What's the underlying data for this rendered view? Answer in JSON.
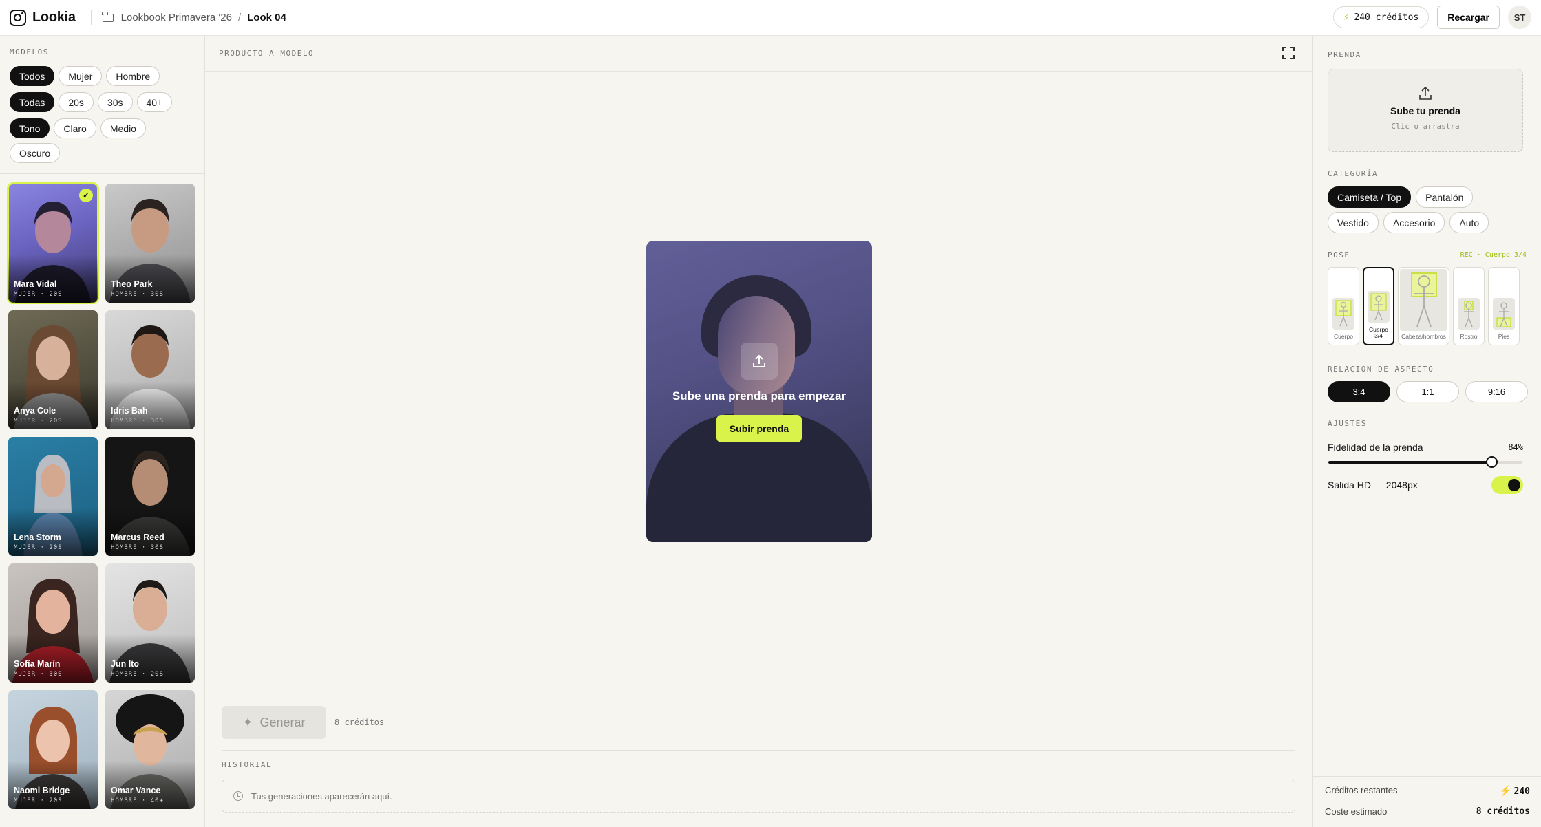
{
  "app": {
    "name": "Lookia"
  },
  "breadcrumb": {
    "project": "Lookbook Primavera '26",
    "separator": "/",
    "current": "Look 04"
  },
  "header": {
    "credits": "240 créditos",
    "reload_label": "Recargar",
    "avatar_initials": "ST"
  },
  "sidebar": {
    "title": "MODELOS",
    "gender_filters": [
      "Todos",
      "Mujer",
      "Hombre"
    ],
    "age_filters": [
      "Todas",
      "20s",
      "30s",
      "40+"
    ],
    "tone_filters": [
      "Tono",
      "Claro",
      "Medio",
      "Oscuro"
    ],
    "models": [
      {
        "name": "Mara Vidal",
        "meta": "MUJER · 20S",
        "selected": true
      },
      {
        "name": "Theo Park",
        "meta": "HOMBRE · 30S"
      },
      {
        "name": "Anya Cole",
        "meta": "MUJER · 20S"
      },
      {
        "name": "Idris Bah",
        "meta": "HOMBRE · 30S"
      },
      {
        "name": "Lena Storm",
        "meta": "MUJER · 20S"
      },
      {
        "name": "Marcus Reed",
        "meta": "HOMBRE · 30S"
      },
      {
        "name": "Sofía Marín",
        "meta": "MUJER · 30S"
      },
      {
        "name": "Jun Ito",
        "meta": "HOMBRE · 20S"
      },
      {
        "name": "Naomi Bridge",
        "meta": "MUJER · 20S"
      },
      {
        "name": "Omar Vance",
        "meta": "HOMBRE · 40+"
      }
    ]
  },
  "main": {
    "title": "PRODUCTO A MODELO",
    "preview_title": "Sube una prenda para empezar",
    "preview_button": "Subir prenda",
    "generate_label": "Generar",
    "generate_cost": "8 créditos",
    "history_title": "HISTORIAL",
    "history_empty": "Tus generaciones aparecerán aquí."
  },
  "panel": {
    "garment_title": "PRENDA",
    "upload_title": "Sube tu prenda",
    "upload_sub": "Clic o arrastra",
    "category_title": "CATEGORÍA",
    "categories_row1": [
      "Camiseta / Top",
      "Pantalón"
    ],
    "categories_row2": [
      "Vestido",
      "Accesorio",
      "Auto"
    ],
    "pose_title": "POSE",
    "pose_rec": "REC · Cuerpo 3/4",
    "poses": [
      "Cuerpo",
      "Cuerpo 3/4",
      "Cabeza/hombros",
      "Rostro",
      "Pies"
    ],
    "aspect_title": "RELACIÓN DE ASPECTO",
    "aspects": [
      "3:4",
      "1:1",
      "9:16"
    ],
    "settings_title": "AJUSTES",
    "fidelity_label": "Fidelidad de la prenda",
    "fidelity_value": "84%",
    "fidelity_fraction": 0.84,
    "hd_label": "Salida HD — 2048px",
    "hd_on": true,
    "credits_left_label": "Créditos restantes",
    "credits_left_value": "240",
    "cost_label": "Coste estimado",
    "cost_value": "8 créditos"
  },
  "colors": {
    "accent": "#d9f34a",
    "ink": "#111111",
    "background": "#f6f5f0"
  },
  "icons": [
    "logo-icon",
    "folder-icon",
    "bolt-icon",
    "check-icon",
    "expand-icon",
    "upload-icon",
    "sparkle-icon",
    "clock-icon"
  ]
}
